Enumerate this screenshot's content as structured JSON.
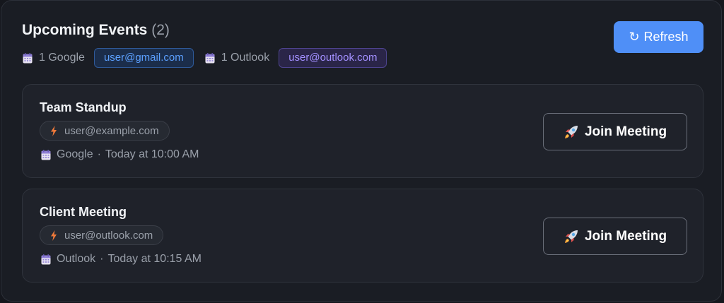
{
  "header": {
    "title": "Upcoming Events",
    "count": "(2)",
    "refresh_label": "Refresh",
    "refresh_icon": "↻"
  },
  "accounts": [
    {
      "label": "1 Google",
      "email": "user@gmail.com",
      "icon": "calendar-icon"
    },
    {
      "label": "1 Outlook",
      "email": "user@outlook.com",
      "icon": "calendar-icon"
    }
  ],
  "events": [
    {
      "title": "Team Standup",
      "organizer": "user@example.com",
      "provider": "Google",
      "separator": "·",
      "time": "Today at 10:00 AM",
      "join_label": "Join Meeting"
    },
    {
      "title": "Client Meeting",
      "organizer": "user@outlook.com",
      "provider": "Outlook",
      "separator": "·",
      "time": "Today at 10:15 AM",
      "join_label": "Join Meeting"
    }
  ],
  "colors": {
    "accent": "#4f8ff7",
    "google_chip": "#5ca0ff",
    "outlook_chip": "#a390ff",
    "background": "#1a1d24"
  }
}
